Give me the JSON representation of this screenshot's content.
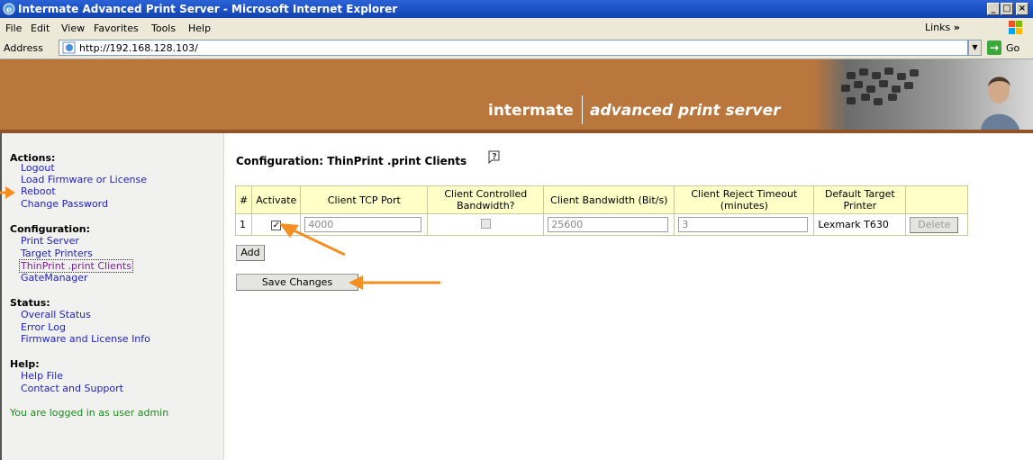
{
  "window": {
    "title": "Intermate Advanced Print Server - Microsoft Internet Explorer"
  },
  "menu": {
    "items": [
      "File",
      "Edit",
      "View",
      "Favorites",
      "Tools",
      "Help"
    ],
    "links_label": "Links",
    "links_chevron": "»"
  },
  "address": {
    "label": "Address",
    "url": "http://192.168.128.103/",
    "go_label": "Go"
  },
  "banner": {
    "brand_primary": "intermate",
    "brand_secondary": "advanced print server"
  },
  "sidebar": {
    "actions": {
      "heading": "Actions:",
      "items": [
        "Logout",
        "Load Firmware or License",
        "Reboot",
        "Change Password"
      ]
    },
    "configuration": {
      "heading": "Configuration:",
      "items": [
        "Print Server",
        "Target Printers",
        "ThinPrint .print Clients",
        "GateManager"
      ]
    },
    "status": {
      "heading": "Status:",
      "items": [
        "Overall Status",
        "Error Log",
        "Firmware and License Info"
      ]
    },
    "help": {
      "heading": "Help:",
      "items": [
        "Help File",
        "Contact and Support"
      ]
    },
    "login_status": "You are logged in as user admin"
  },
  "main": {
    "title": "Configuration: ThinPrint .print Clients",
    "table": {
      "headers": [
        "#",
        "Activate",
        "Client TCP Port",
        "Client Controlled Bandwidth?",
        "Client Bandwidth (Bit/s)",
        "Client Reject Timeout (minutes)",
        "Default Target Printer",
        ""
      ],
      "row": {
        "index": "1",
        "activate": true,
        "tcp_port": "4000",
        "client_controlled_bandwidth": false,
        "bandwidth": "25600",
        "reject_timeout": "3",
        "default_printer": "Lexmark T630",
        "delete_label": "Delete"
      }
    },
    "add_label": "Add",
    "save_label": "Save Changes"
  },
  "icons": {
    "window": "ie-icon",
    "help": "help-icon",
    "go": "go-arrow-icon",
    "windows_logo": "windows-logo-icon",
    "page": "page-icon"
  },
  "colors": {
    "banner": "#b9763d",
    "table_header": "#ffffc8",
    "annotation_arrow": "#f39021",
    "link": "#1f1fbf",
    "visited_link": "#7b1f9b",
    "login_text": "#1c8a1c"
  }
}
